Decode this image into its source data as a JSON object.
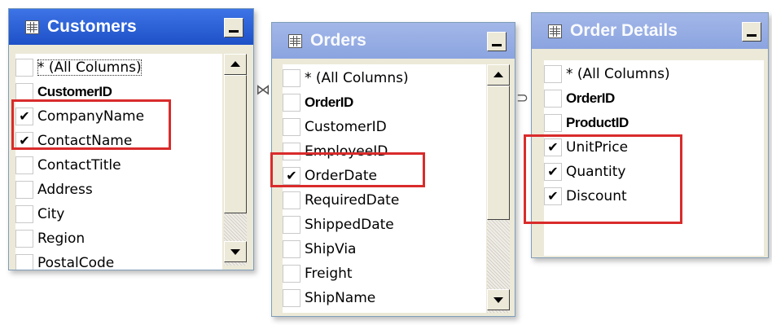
{
  "tables": [
    {
      "name": "Customers",
      "columns": [
        {
          "label": "* (All Columns)",
          "checked": false,
          "key": false
        },
        {
          "label": "CustomerID",
          "checked": false,
          "key": true
        },
        {
          "label": "CompanyName",
          "checked": true,
          "key": false
        },
        {
          "label": "ContactName",
          "checked": true,
          "key": false
        },
        {
          "label": "ContactTitle",
          "checked": false,
          "key": false
        },
        {
          "label": "Address",
          "checked": false,
          "key": false
        },
        {
          "label": "City",
          "checked": false,
          "key": false
        },
        {
          "label": "Region",
          "checked": false,
          "key": false
        },
        {
          "label": "PostalCode",
          "checked": false,
          "key": false
        }
      ]
    },
    {
      "name": "Orders",
      "columns": [
        {
          "label": "* (All Columns)",
          "checked": false,
          "key": false
        },
        {
          "label": "OrderID",
          "checked": false,
          "key": true
        },
        {
          "label": "CustomerID",
          "checked": false,
          "key": false
        },
        {
          "label": "EmployeeID",
          "checked": false,
          "key": false
        },
        {
          "label": "OrderDate",
          "checked": true,
          "key": false
        },
        {
          "label": "RequiredDate",
          "checked": false,
          "key": false
        },
        {
          "label": "ShippedDate",
          "checked": false,
          "key": false
        },
        {
          "label": "ShipVia",
          "checked": false,
          "key": false
        },
        {
          "label": "Freight",
          "checked": false,
          "key": false
        },
        {
          "label": "ShipName",
          "checked": false,
          "key": false
        }
      ]
    },
    {
      "name": "Order Details",
      "columns": [
        {
          "label": "* (All Columns)",
          "checked": false,
          "key": false
        },
        {
          "label": "OrderID",
          "checked": false,
          "key": true
        },
        {
          "label": "ProductID",
          "checked": false,
          "key": true
        },
        {
          "label": "UnitPrice",
          "checked": true,
          "key": false
        },
        {
          "label": "Quantity",
          "checked": true,
          "key": false
        },
        {
          "label": "Discount",
          "checked": true,
          "key": false
        }
      ]
    }
  ],
  "check_glyph": "✔",
  "colors": {
    "active_title": "#2b63d7",
    "inactive_title": "#8ba4e0",
    "highlight": "#d92b2b"
  }
}
